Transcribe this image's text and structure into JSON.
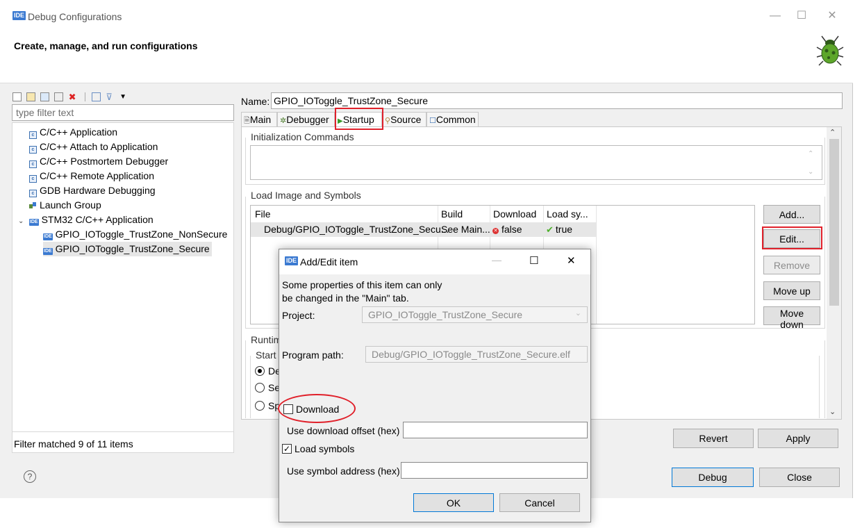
{
  "window": {
    "badge": "IDE",
    "title": "Debug Configurations",
    "header_title": "Create, manage, and run configurations",
    "minimize": "—",
    "maximize": "☐",
    "close": "✕"
  },
  "left": {
    "filter_placeholder": "type filter text",
    "tree_items": [
      {
        "label": "C/C++ Application",
        "icon": "c-config-icon"
      },
      {
        "label": "C/C++ Attach to Application",
        "icon": "c-config-icon"
      },
      {
        "label": "C/C++ Postmortem Debugger",
        "icon": "c-config-icon"
      },
      {
        "label": "C/C++ Remote Application",
        "icon": "c-config-icon"
      },
      {
        "label": "GDB Hardware Debugging",
        "icon": "c-config-icon"
      },
      {
        "label": "Launch Group",
        "icon": "launch-group-icon"
      },
      {
        "label": "STM32 C/C++ Application",
        "icon": "ide-icon",
        "expanded": true
      },
      {
        "label": "GPIO_IOToggle_TrustZone_NonSecure",
        "icon": "ide-icon"
      },
      {
        "label": "GPIO_IOToggle_TrustZone_Secure",
        "icon": "ide-icon",
        "selected": true
      }
    ],
    "filter_status": "Filter matched 9 of 11 items"
  },
  "right": {
    "name_label": "Name:",
    "name_value": "GPIO_IOToggle_TrustZone_Secure",
    "tabs": [
      {
        "label": "Main",
        "icon": "main-tab-icon"
      },
      {
        "label": "Debugger",
        "icon": "debugger-tab-icon"
      },
      {
        "label": "Startup",
        "icon": "startup-tab-icon",
        "active": true
      },
      {
        "label": "Source",
        "icon": "source-tab-icon"
      },
      {
        "label": "Common",
        "icon": "common-tab-icon"
      }
    ],
    "init_commands_label": "Initialization Commands",
    "load_image_label": "Load Image and Symbols",
    "table": {
      "headers": [
        "File",
        "Build",
        "Download",
        "Load sy..."
      ],
      "rows": [
        {
          "file": "Debug/GPIO_IOToggle_TrustZone_Secu...",
          "build": "See Main...",
          "download": "false",
          "load_symbols": "true"
        }
      ]
    },
    "buttons": {
      "add": "Add...",
      "edit": "Edit...",
      "remove": "Remove",
      "move_up": "Move up",
      "move_down": "Move down"
    },
    "runtime_label_partial": "Runtim",
    "start_label_partial": "Start /",
    "radio_partials": [
      "De",
      "Set",
      "Sp"
    ],
    "revert": "Revert",
    "apply": "Apply"
  },
  "footer": {
    "help": "?",
    "debug": "Debug",
    "close": "Close"
  },
  "dialog": {
    "badge": "IDE",
    "title": "Add/Edit item",
    "minimize": "—",
    "maximize": "☐",
    "close": "✕",
    "info_line1": "Some properties of this item can only",
    "info_line2": "be changed in the \"Main\" tab.",
    "project_label": "Project:",
    "project_value": "GPIO_IOToggle_TrustZone_Secure",
    "program_path_label": "Program path:",
    "program_path_value": "Debug/GPIO_IOToggle_TrustZone_Secure.elf",
    "download_label": "Download",
    "download_checked": false,
    "download_offset_label": "Use download offset (hex)",
    "load_symbols_label": "Load symbols",
    "load_symbols_checked": true,
    "symbol_address_label": "Use symbol address (hex)",
    "ok": "OK",
    "cancel": "Cancel"
  },
  "colors": {
    "highlight_red": "#e0202a",
    "ide_blue": "#3b7ad1",
    "selection_gray": "#e6e6e6"
  }
}
